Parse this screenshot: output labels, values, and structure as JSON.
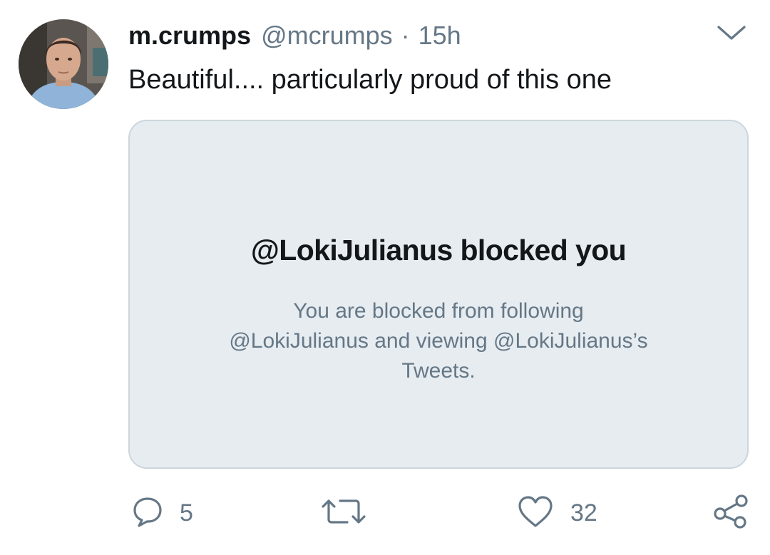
{
  "tweet": {
    "display_name": "m.crumps",
    "handle": "@mcrumps",
    "separator": "·",
    "time": "15h",
    "text": "Beautiful.... particularly proud of this one"
  },
  "card": {
    "title": "@LokiJulianus blocked you",
    "body_lines": [
      "You are blocked from following",
      "@LokiJulianus and viewing @LokiJulianus’s",
      "Tweets."
    ]
  },
  "actions": {
    "reply_count": "5",
    "retweet_count": "",
    "like_count": "32"
  },
  "icons": {
    "menu": "chevron-down-icon",
    "reply": "comment-bubble-icon",
    "retweet": "retweet-arrows-icon",
    "like": "heart-icon",
    "share": "share-nodes-icon"
  },
  "colors": {
    "text_primary": "#14171a",
    "text_secondary": "#657786",
    "card_background": "#e6ecf0",
    "card_border": "#ccd6dd"
  }
}
